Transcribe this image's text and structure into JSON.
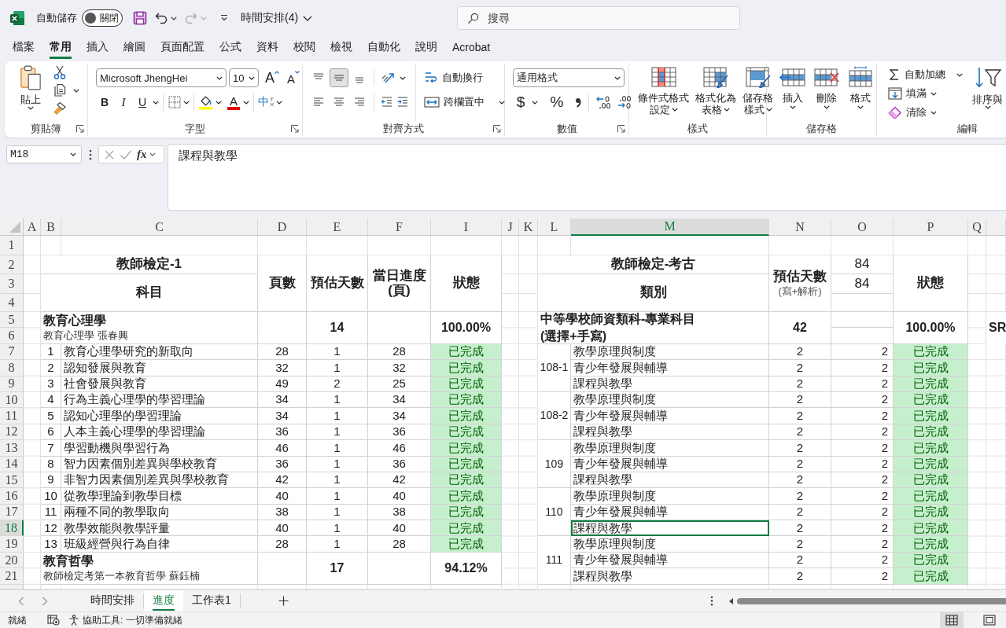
{
  "title_bar": {
    "autosave_label": "自動儲存",
    "autosave_toggle": {
      "label": "關閉",
      "on": false
    },
    "quick_access": [
      {
        "kind": "save",
        "disabled": false
      },
      {
        "kind": "undo",
        "disabled": false
      },
      {
        "kind": "redo",
        "disabled": true
      },
      {
        "kind": "customize",
        "disabled": false
      }
    ],
    "document_title": "時間安排(4)",
    "search": {
      "placeholder": "搜尋"
    }
  },
  "ribbon_tabs": [
    {
      "label": "檔案",
      "selected": false
    },
    {
      "label": "常用",
      "selected": true
    },
    {
      "label": "插入",
      "selected": false
    },
    {
      "label": "繪圖",
      "selected": false
    },
    {
      "label": "頁面配置",
      "selected": false
    },
    {
      "label": "公式",
      "selected": false
    },
    {
      "label": "資料",
      "selected": false
    },
    {
      "label": "校閱",
      "selected": false
    },
    {
      "label": "檢視",
      "selected": false
    },
    {
      "label": "自動化",
      "selected": false
    },
    {
      "label": "說明",
      "selected": false
    },
    {
      "label": "Acrobat",
      "selected": false
    }
  ],
  "ribbon": {
    "clipboard": {
      "label": "剪貼簿",
      "paste": "貼上"
    },
    "font": {
      "label": "字型",
      "font_name": "Microsoft JhengHei",
      "font_size": "10",
      "grow": "A",
      "shrink": "A",
      "styles": [
        {
          "kind": "bold",
          "label": "B"
        },
        {
          "kind": "italic",
          "label": "I"
        },
        {
          "kind": "underline",
          "label": "U"
        }
      ],
      "font_color": "A",
      "phonetic": "中"
    },
    "alignment": {
      "label": "對齊方式",
      "vertical": [
        {
          "kind": "top",
          "selected": false
        },
        {
          "kind": "middle",
          "selected": true
        },
        {
          "kind": "bottom",
          "selected": false
        }
      ],
      "horizontal": [
        {
          "kind": "left",
          "selected": false
        },
        {
          "kind": "center",
          "selected": false
        },
        {
          "kind": "right",
          "selected": false
        }
      ],
      "wrap_text": "自動換行",
      "merge_center": "跨欄置中"
    },
    "number": {
      "label": "數值",
      "format": "通用格式",
      "currency": "$",
      "percent": "%"
    },
    "styles": {
      "label": "樣式",
      "buttons": [
        {
          "kind": "conditional",
          "lines": [
            "條件式格式",
            "設定"
          ]
        },
        {
          "kind": "table",
          "lines": [
            "格式化為",
            "表格"
          ]
        },
        {
          "kind": "cell",
          "lines": [
            "儲存格",
            "樣式"
          ]
        }
      ]
    },
    "cells": {
      "label": "儲存格",
      "buttons": [
        {
          "kind": "insert",
          "label": "插入"
        },
        {
          "kind": "delete",
          "label": "刪除"
        },
        {
          "kind": "format",
          "label": "格式"
        }
      ]
    },
    "editing": {
      "label": "編輯",
      "autosum": "自動加總",
      "fill": "填滿",
      "clear": "清除",
      "sort_filter": "排序與"
    }
  },
  "formula_bar": {
    "name_box": "M18",
    "function_label": "fx",
    "formula": "課程與教學"
  },
  "sheet": {
    "column_headers": [
      {
        "label": "A",
        "selected": false
      },
      {
        "label": "B",
        "selected": false
      },
      {
        "label": "C",
        "selected": false
      },
      {
        "label": "D",
        "selected": false
      },
      {
        "label": "E",
        "selected": false
      },
      {
        "label": "F",
        "selected": false
      },
      {
        "label": "I",
        "selected": false
      },
      {
        "label": "J",
        "selected": false
      },
      {
        "label": "K",
        "selected": false
      },
      {
        "label": "L",
        "selected": false
      },
      {
        "label": "M",
        "selected": true
      },
      {
        "label": "N",
        "selected": false
      },
      {
        "label": "O",
        "selected": false
      },
      {
        "label": "P",
        "selected": false
      },
      {
        "label": "Q",
        "selected": false
      }
    ],
    "row_headers": [
      {
        "label": "1",
        "selected": false
      },
      {
        "label": "2",
        "selected": false
      },
      {
        "label": "3",
        "selected": false
      },
      {
        "label": "4",
        "selected": false
      },
      {
        "label": "5",
        "selected": false
      },
      {
        "label": "6",
        "selected": false
      },
      {
        "label": "7",
        "selected": false
      },
      {
        "label": "8",
        "selected": false
      },
      {
        "label": "9",
        "selected": false
      },
      {
        "label": "10",
        "selected": false
      },
      {
        "label": "11",
        "selected": false
      },
      {
        "label": "12",
        "selected": false
      },
      {
        "label": "13",
        "selected": false
      },
      {
        "label": "14",
        "selected": false
      },
      {
        "label": "15",
        "selected": false
      },
      {
        "label": "16",
        "selected": false
      },
      {
        "label": "17",
        "selected": false
      },
      {
        "label": "18",
        "selected": true
      },
      {
        "label": "19",
        "selected": false
      },
      {
        "label": "20",
        "selected": false
      },
      {
        "label": "21",
        "selected": false
      }
    ],
    "left_table": {
      "title": "教師檢定-1",
      "subject_header": "科目",
      "column_headers": [
        [
          "頁數"
        ],
        [
          "預估天數"
        ],
        [
          "當日進度",
          "(頁)"
        ],
        [
          "狀態"
        ]
      ],
      "sections": [
        {
          "name": "教育心理學",
          "book": "教育心理學 張春興",
          "days": "14",
          "progress": "100.00%",
          "chapters": [
            {
              "number": "1",
              "title": "教育心理學研究的新取向",
              "pages": "28",
              "days": "1",
              "pages_per_day": "28",
              "status": {
                "text": "已完成",
                "kind": "done"
              }
            },
            {
              "number": "2",
              "title": "認知發展與教育",
              "pages": "32",
              "days": "1",
              "pages_per_day": "32",
              "status": {
                "text": "已完成",
                "kind": "done"
              }
            },
            {
              "number": "3",
              "title": "社會發展與教育",
              "pages": "49",
              "days": "2",
              "pages_per_day": "25",
              "status": {
                "text": "已完成",
                "kind": "done"
              }
            },
            {
              "number": "4",
              "title": "行為主義心理學的學習理論",
              "pages": "34",
              "days": "1",
              "pages_per_day": "34",
              "status": {
                "text": "已完成",
                "kind": "done"
              }
            },
            {
              "number": "5",
              "title": "認知心理學的學習理論",
              "pages": "34",
              "days": "1",
              "pages_per_day": "34",
              "status": {
                "text": "已完成",
                "kind": "done"
              }
            },
            {
              "number": "6",
              "title": "人本主義心理學的學習理論",
              "pages": "36",
              "days": "1",
              "pages_per_day": "36",
              "status": {
                "text": "已完成",
                "kind": "done"
              }
            },
            {
              "number": "7",
              "title": "學習動機與學習行為",
              "pages": "46",
              "days": "1",
              "pages_per_day": "46",
              "status": {
                "text": "已完成",
                "kind": "done"
              }
            },
            {
              "number": "8",
              "title": "智力因素個別差異與學校教育",
              "pages": "36",
              "days": "1",
              "pages_per_day": "36",
              "status": {
                "text": "已完成",
                "kind": "done"
              }
            },
            {
              "number": "9",
              "title": "非智力因素個別差異與學校教育",
              "pages": "42",
              "days": "1",
              "pages_per_day": "42",
              "status": {
                "text": "已完成",
                "kind": "done"
              }
            },
            {
              "number": "10",
              "title": "從教學理論到教學目標",
              "pages": "40",
              "days": "1",
              "pages_per_day": "40",
              "status": {
                "text": "已完成",
                "kind": "done"
              }
            },
            {
              "number": "11",
              "title": "兩種不同的教學取向",
              "pages": "38",
              "days": "1",
              "pages_per_day": "38",
              "status": {
                "text": "已完成",
                "kind": "done"
              }
            },
            {
              "number": "12",
              "title": "教學效能與教學評量",
              "pages": "40",
              "days": "1",
              "pages_per_day": "40",
              "status": {
                "text": "已完成",
                "kind": "done"
              }
            },
            {
              "number": "13",
              "title": "班級經營與行為自律",
              "pages": "28",
              "days": "1",
              "pages_per_day": "28",
              "status": {
                "text": "已完成",
                "kind": "done"
              }
            }
          ]
        },
        {
          "name": "教育哲學",
          "book": "教師檢定考第一本教育哲學 蘇鈺楠",
          "days": "17",
          "progress": "94.12%"
        }
      ]
    },
    "right_table": {
      "title": "教師檢定-考古",
      "category_header": "類別",
      "days_header": "預估天數",
      "days_note": "(寫+解析)",
      "column_3_totals": [
        "84",
        "84"
      ],
      "status_header": "狀態",
      "sections": [
        {
          "name_lines": [
            "中等學校師資類科-專業科目",
            "(選擇+手寫)"
          ],
          "days": "42",
          "progress": "100.00%",
          "cut_off_text": "SR",
          "years": [
            {
              "label": "108-1",
              "items": [
                {
                  "title": "教學原理與制度",
                  "days": "2",
                  "column_3": "2",
                  "status": {
                    "text": "已完成",
                    "kind": "done"
                  },
                  "selected": false
                },
                {
                  "title": "青少年發展與輔導",
                  "days": "2",
                  "column_3": "2",
                  "status": {
                    "text": "已完成",
                    "kind": "done"
                  },
                  "selected": false
                },
                {
                  "title": "課程與教學",
                  "days": "2",
                  "column_3": "2",
                  "status": {
                    "text": "已完成",
                    "kind": "done"
                  },
                  "selected": false
                }
              ]
            },
            {
              "label": "108-2",
              "items": [
                {
                  "title": "教學原理與制度",
                  "days": "2",
                  "column_3": "2",
                  "status": {
                    "text": "已完成",
                    "kind": "done"
                  },
                  "selected": false
                },
                {
                  "title": "青少年發展與輔導",
                  "days": "2",
                  "column_3": "2",
                  "status": {
                    "text": "已完成",
                    "kind": "done"
                  },
                  "selected": false
                },
                {
                  "title": "課程與教學",
                  "days": "2",
                  "column_3": "2",
                  "status": {
                    "text": "已完成",
                    "kind": "done"
                  },
                  "selected": false
                }
              ]
            },
            {
              "label": "109",
              "items": [
                {
                  "title": "教學原理與制度",
                  "days": "2",
                  "column_3": "2",
                  "status": {
                    "text": "已完成",
                    "kind": "done"
                  },
                  "selected": false
                },
                {
                  "title": "青少年發展與輔導",
                  "days": "2",
                  "column_3": "2",
                  "status": {
                    "text": "已完成",
                    "kind": "done"
                  },
                  "selected": false
                },
                {
                  "title": "課程與教學",
                  "days": "2",
                  "column_3": "2",
                  "status": {
                    "text": "已完成",
                    "kind": "done"
                  },
                  "selected": false
                }
              ]
            },
            {
              "label": "110",
              "items": [
                {
                  "title": "教學原理與制度",
                  "days": "2",
                  "column_3": "2",
                  "status": {
                    "text": "已完成",
                    "kind": "done"
                  },
                  "selected": false
                },
                {
                  "title": "青少年發展與輔導",
                  "days": "2",
                  "column_3": "2",
                  "status": {
                    "text": "已完成",
                    "kind": "done"
                  },
                  "selected": false
                },
                {
                  "title": "課程與教學",
                  "days": "2",
                  "column_3": "2",
                  "status": {
                    "text": "已完成",
                    "kind": "done"
                  },
                  "selected": true
                }
              ]
            },
            {
              "label": "111",
              "items": [
                {
                  "title": "教學原理與制度",
                  "days": "2",
                  "column_3": "2",
                  "status": {
                    "text": "已完成",
                    "kind": "done"
                  },
                  "selected": false
                },
                {
                  "title": "青少年發展與輔導",
                  "days": "2",
                  "column_3": "2",
                  "status": {
                    "text": "已完成",
                    "kind": "done"
                  },
                  "selected": false
                },
                {
                  "title": "課程與教學",
                  "days": "2",
                  "column_3": "2",
                  "status": {
                    "text": "已完成",
                    "kind": "done"
                  },
                  "selected": false
                }
              ]
            }
          ]
        }
      ]
    }
  },
  "sheet_tabs": [
    {
      "label": "時間安排",
      "selected": false
    },
    {
      "label": "進度",
      "selected": true
    },
    {
      "label": "工作表1",
      "selected": false
    }
  ],
  "status_bar": {
    "status": "就緒",
    "accessibility": "協助工具: 一切準備就緒",
    "views": [
      {
        "kind": "normal",
        "selected": true
      },
      {
        "kind": "page_layout",
        "selected": false
      }
    ]
  }
}
